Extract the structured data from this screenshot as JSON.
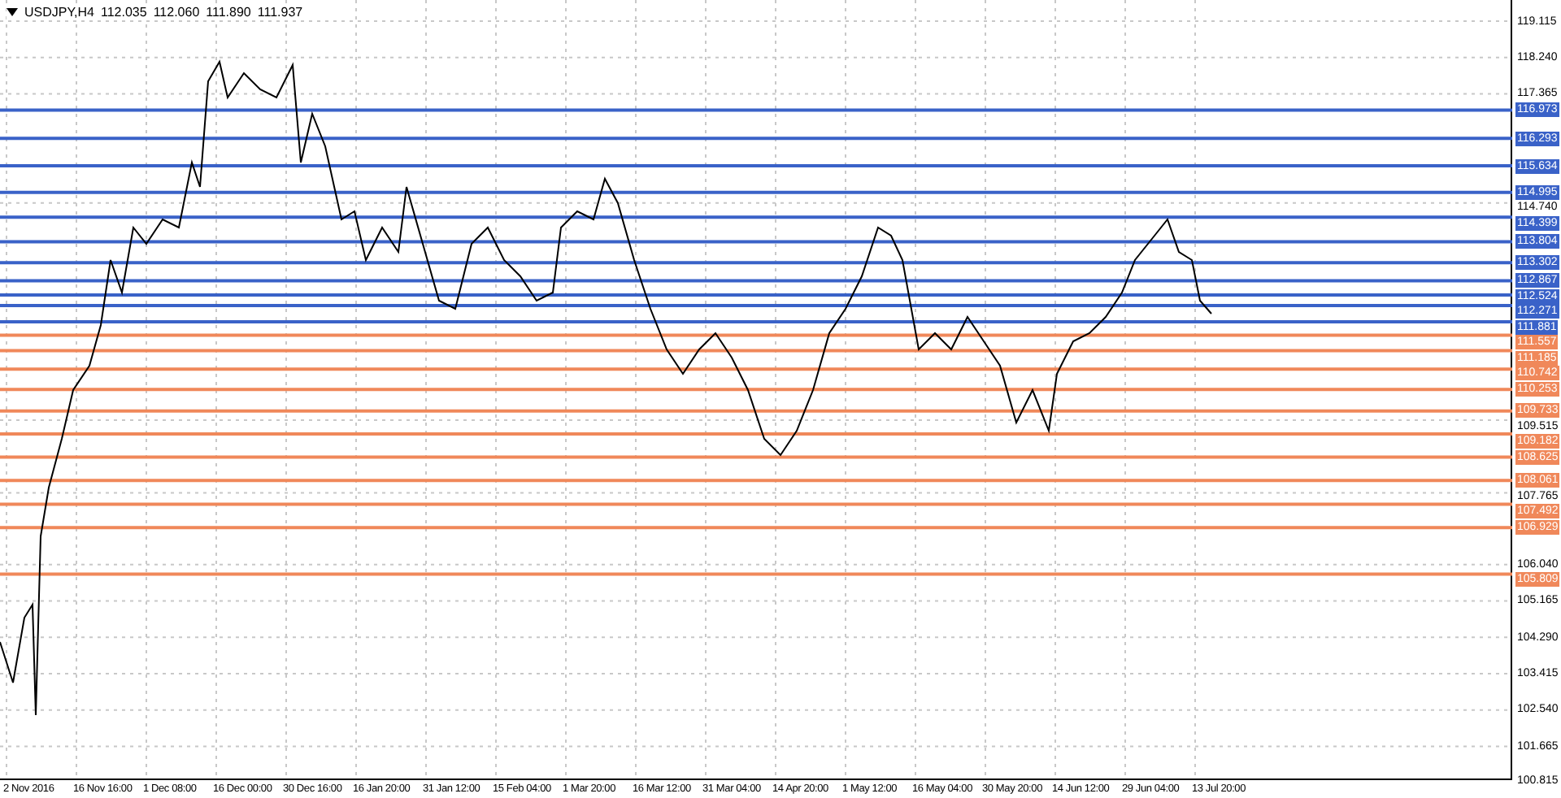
{
  "chart": {
    "symbol": "USDJPY,H4",
    "ohlc": [
      "112.035",
      "112.060",
      "111.890",
      "111.937"
    ]
  },
  "levels": [
    {
      "price": "116.973",
      "kind": "resistance"
    },
    {
      "price": "116.293",
      "kind": "resistance"
    },
    {
      "price": "115.634",
      "kind": "resistance"
    },
    {
      "price": "114.995",
      "kind": "resistance"
    },
    {
      "price": "114.399",
      "kind": "resistance"
    },
    {
      "price": "113.804",
      "kind": "resistance"
    },
    {
      "price": "113.302",
      "kind": "resistance"
    },
    {
      "price": "112.867",
      "kind": "resistance"
    },
    {
      "price": "112.524",
      "kind": "resistance"
    },
    {
      "price": "112.271",
      "kind": "resistance"
    },
    {
      "price": "111.881",
      "kind": "resistance"
    },
    {
      "price": "111.557",
      "kind": "support"
    },
    {
      "price": "111.185",
      "kind": "support"
    },
    {
      "price": "110.742",
      "kind": "support"
    },
    {
      "price": "110.253",
      "kind": "support"
    },
    {
      "price": "109.733",
      "kind": "support"
    },
    {
      "price": "109.182",
      "kind": "support"
    },
    {
      "price": "108.625",
      "kind": "support"
    },
    {
      "price": "108.061",
      "kind": "support"
    },
    {
      "price": "107.492",
      "kind": "support"
    },
    {
      "price": "106.929",
      "kind": "support"
    },
    {
      "price": "105.809",
      "kind": "support"
    }
  ],
  "price_axis": {
    "ticks": [
      "119.115",
      "118.240",
      "117.365",
      "114.740",
      "109.515",
      "107.765",
      "106.040",
      "105.165",
      "104.290",
      "103.415",
      "102.540",
      "101.665",
      "100.815"
    ]
  },
  "time_axis": {
    "labels": [
      "2 Nov 2016",
      "16 Nov 16:00",
      "1 Dec 08:00",
      "16 Dec 00:00",
      "30 Dec 16:00",
      "16 Jan 20:00",
      "31 Jan 12:00",
      "15 Feb 04:00",
      "1 Mar 20:00",
      "16 Mar 12:00",
      "31 Mar 04:00",
      "14 Apr 20:00",
      "1 May 12:00",
      "16 May 04:00",
      "30 May 20:00",
      "14 Jun 12:00",
      "29 Jun 04:00",
      "13 Jul 20:00"
    ]
  }
}
